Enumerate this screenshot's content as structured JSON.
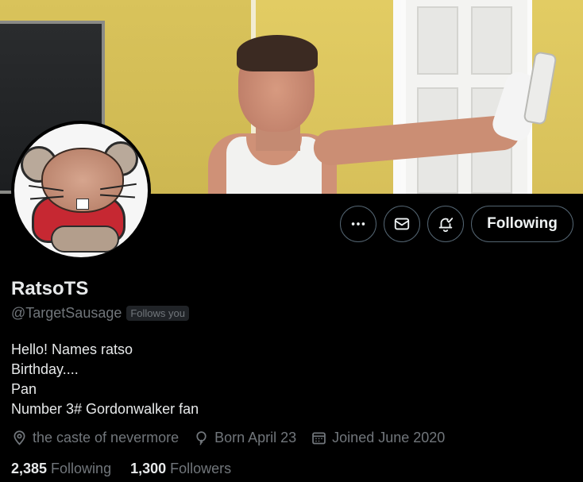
{
  "profile": {
    "display_name": "RatsoTS",
    "handle": "@TargetSausage",
    "follows_you_badge": "Follows you",
    "bio_lines": [
      "Hello! Names ratso",
      "Birthday....",
      "Pan",
      "Number 3# Gordonwalker fan"
    ],
    "location": "the caste of nevermore",
    "birthday": "Born April 23",
    "joined": "Joined June 2020"
  },
  "actions": {
    "more_icon": "ellipsis-icon",
    "message_icon": "envelope-icon",
    "notify_icon": "bell-check-icon",
    "follow_label": "Following"
  },
  "stats": {
    "following_count": "2,385",
    "following_label": "Following",
    "followers_count": "1,300",
    "followers_label": "Followers"
  },
  "colors": {
    "background": "#000000",
    "text_primary": "#e7e9ea",
    "text_secondary": "#71767b",
    "border": "#536471"
  }
}
